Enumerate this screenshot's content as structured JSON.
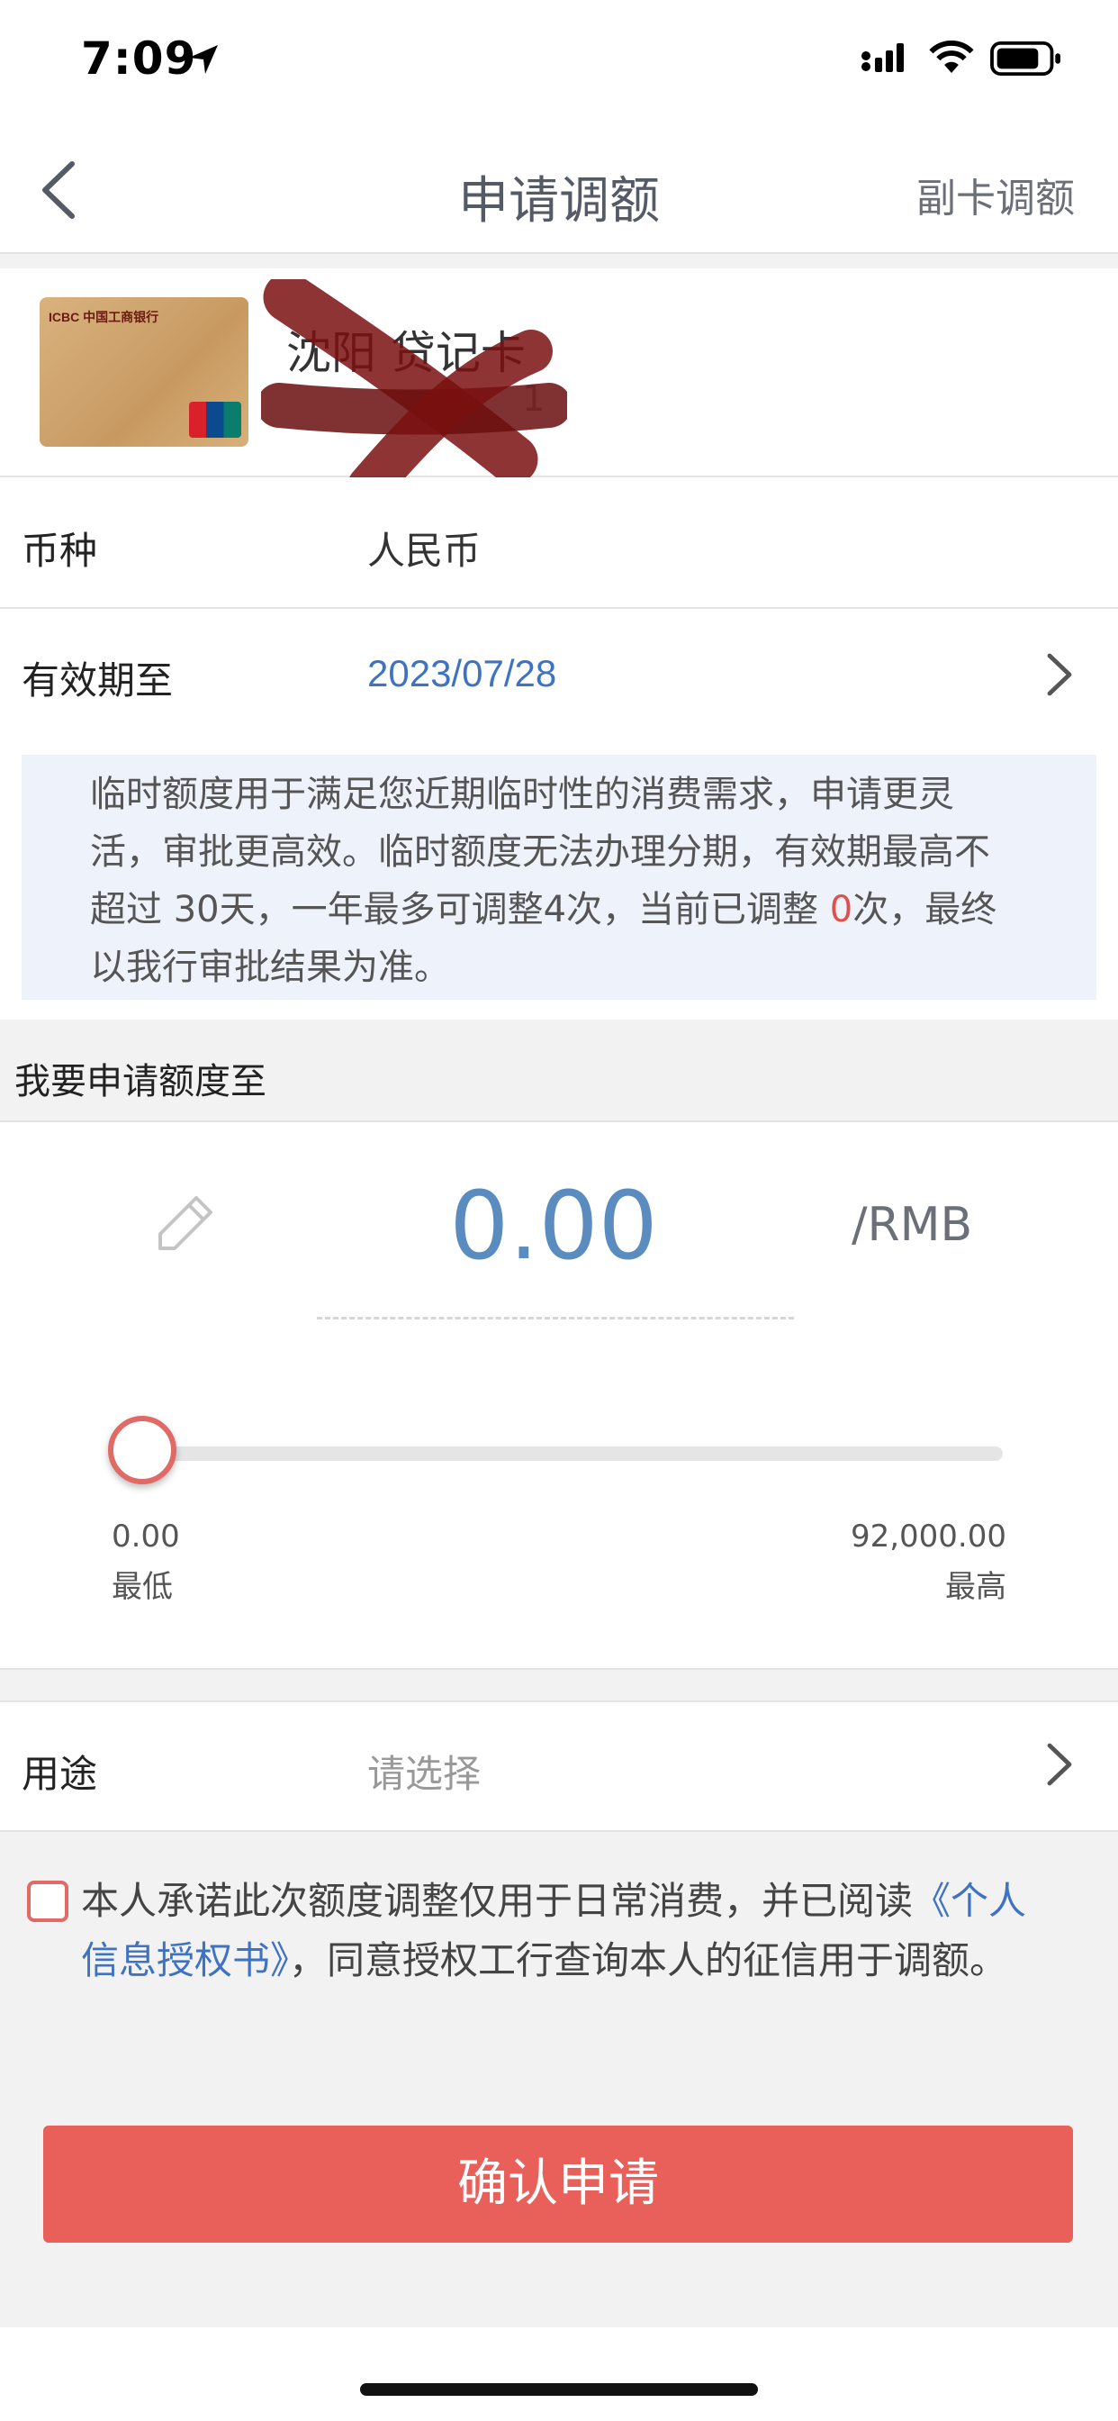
{
  "status_bar": {
    "time": "7:09"
  },
  "nav": {
    "title": "申请调额",
    "right_action": "副卡调额"
  },
  "card": {
    "name": "沈阳   贷记卡",
    "number_tail": "1",
    "bank_mark": "ICBC 中国工商银行"
  },
  "rows": {
    "currency": {
      "label": "币种",
      "value": "人民币"
    },
    "expiry": {
      "label": "有效期至",
      "value": "2023/07/28"
    }
  },
  "notice": {
    "part1": "临时额度用于满足您近期临时性的消费需求，申请更灵活，审批更高效。临时额度无法办理分期，有效期最高不超过 30天，一年最多可调整4次，当前已调整 ",
    "count": "0",
    "part2": "次，最终以我行审批结果为准。"
  },
  "amount_section": {
    "header": "我要申请额度至",
    "amount": "0.00",
    "unit": "/RMB",
    "slider": {
      "min_value": "0.00",
      "min_label": "最低",
      "max_value": "92,000.00",
      "max_label": "最高",
      "level": 0
    }
  },
  "purpose": {
    "label": "用途",
    "placeholder": "请选择"
  },
  "agreement": {
    "text1": "本人承诺此次额度调整仅用于日常消费，并已阅读",
    "link": "《个人信息授权书》",
    "text2": "，同意授权工行查询本人的征信用于调额。",
    "checked": false
  },
  "confirm_button": "确认申请",
  "colors": {
    "accent": "#e9605a",
    "link": "#3f73c2",
    "amount": "#5b8cc0"
  }
}
